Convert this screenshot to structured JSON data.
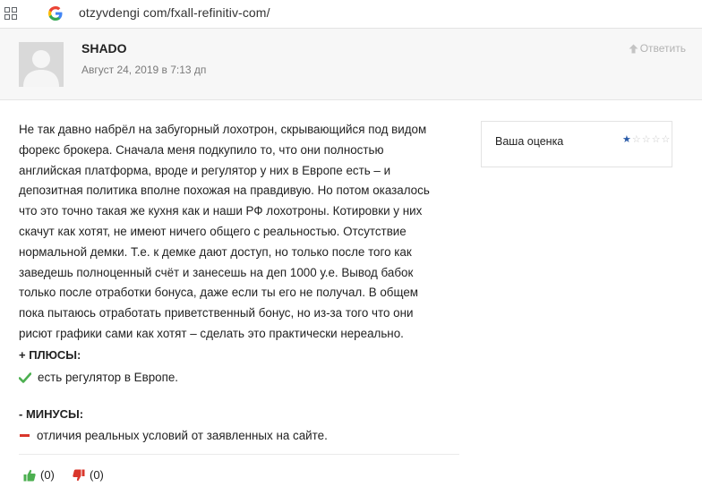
{
  "browser": {
    "url": "otzyvdengi com/fxall-refinitiv-com/"
  },
  "comment": {
    "author": "SHADO",
    "date": "Август 24, 2019 в 7:13 дп",
    "reply_label": "Ответить",
    "body_lines": [
      "Не так давно набрёл на забугорный лохотрон, скрывающийся под видом",
      "форекс брокера. Сначала меня подкупило то, что они полностью",
      "английская платформа, вроде и регулятор у них в Европе есть – и",
      "депозитная политика вполне похожая на правдивую. Но потом оказалось",
      "что это точно такая же кухня как и наши РФ лохотроны. Котировки у них",
      "скачут как хотят, не имеют ничего общего с реальностью. Отсутствие",
      "нормальной демки. Т.е. к демке дают доступ, но только после того как",
      "заведешь полноценный счёт и занесешь на деп 1000 у.е. Вывод бабок",
      "только после отработки бонуса, даже если ты его не получал. В общем",
      "пока пытаюсь отработать приветственный бонус, но из-за того что они",
      "рисют графики сами как хотят – сделать это практически нереально."
    ],
    "rating": {
      "label": "Ваша оценка",
      "value": 1,
      "max": 5,
      "filled_color": "#2a5ba8",
      "empty_color": "#c9c9c9"
    },
    "pros": {
      "title": "+ ПЛЮСЫ:",
      "items": [
        "есть регулятор в Европе."
      ],
      "icon": "check-icon",
      "color": "#4caf50"
    },
    "cons": {
      "title": "- МИНУСЫ:",
      "items": [
        "отличия реальных условий от заявленных на сайте."
      ],
      "icon": "minus-icon",
      "color": "#d9362b"
    },
    "votes": {
      "up": "(0)",
      "down": "(0)",
      "up_color": "#4caf50",
      "down_color": "#d9362b"
    }
  }
}
